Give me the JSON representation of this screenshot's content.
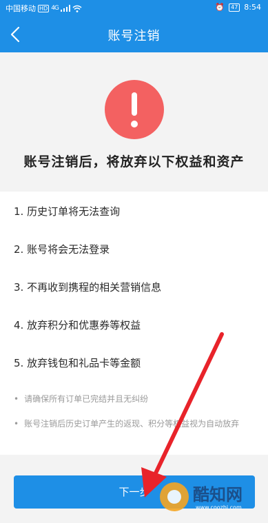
{
  "status_bar": {
    "carrier": "中国移动",
    "hd": "HD",
    "signal": "4G",
    "alarm_icon": "alarm-icon",
    "battery": "47",
    "time": "8:54"
  },
  "nav": {
    "title": "账号注销",
    "back_icon": "back-arrow-icon"
  },
  "warning": {
    "icon": "exclamation-icon",
    "color": "#f36161",
    "headline": "账号注销后，将放弃以下权益和资产"
  },
  "items": [
    "1. 历史订单将无法查询",
    "2. 账号将会无法登录",
    "3. 不再收到携程的相关营销信息",
    "4. 放弃积分和优惠券等权益",
    "5. 放弃钱包和礼品卡等金额"
  ],
  "notes": [
    "请确保所有订单已完结并且无纠纷",
    "账号注销后历史订单产生的返现、积分等权益视为自动放弃"
  ],
  "next_button": "下一步",
  "watermark": {
    "text": "酷知网",
    "url": "www.coozhi.com"
  },
  "colors": {
    "primary": "#1e8fe6",
    "annotation_arrow": "#e8232a"
  }
}
